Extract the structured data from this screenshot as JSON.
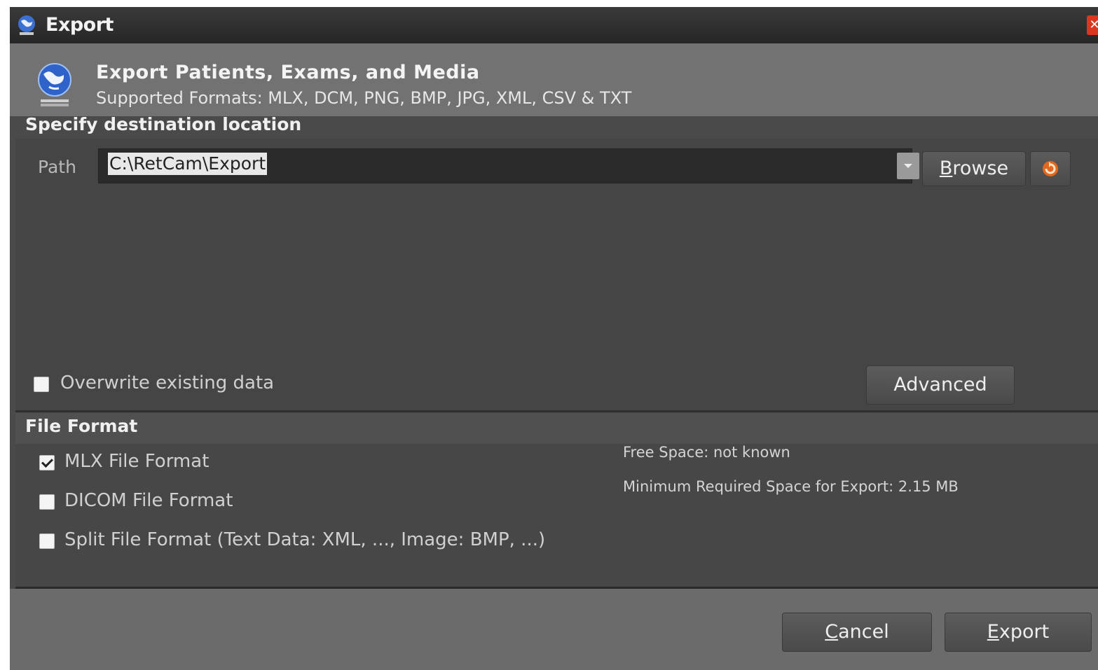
{
  "window": {
    "title": "Export",
    "close_icon": "close-icon"
  },
  "header": {
    "title": "Export Patients, Exams, and Media",
    "subtitle": "Supported Formats: MLX, DCM, PNG, BMP, JPG, XML, CSV & TXT",
    "icon": "globe-export-icon"
  },
  "destination": {
    "section_title": "Specify destination location",
    "path_label": "Path",
    "path_value": "C:\\RetCam\\Export",
    "browse_prefix": "B",
    "browse_rest": "rowse",
    "refresh_icon": "refresh-icon",
    "overwrite_label": "Overwrite existing data",
    "overwrite_checked": false,
    "advanced_label": "Advanced"
  },
  "file_format": {
    "section_title": "File Format",
    "options": [
      {
        "label": "MLX File Format",
        "checked": true
      },
      {
        "label": "DICOM File Format",
        "checked": false
      },
      {
        "label": "Split File Format (Text Data: XML, ..., Image: BMP, ...)",
        "checked": false
      }
    ],
    "free_space": "Free Space: not known",
    "min_required": "Minimum Required Space for Export: 2.15 MB"
  },
  "footer": {
    "cancel_prefix": "C",
    "cancel_rest": "ancel",
    "export_prefix": "E",
    "export_rest": "xport"
  }
}
